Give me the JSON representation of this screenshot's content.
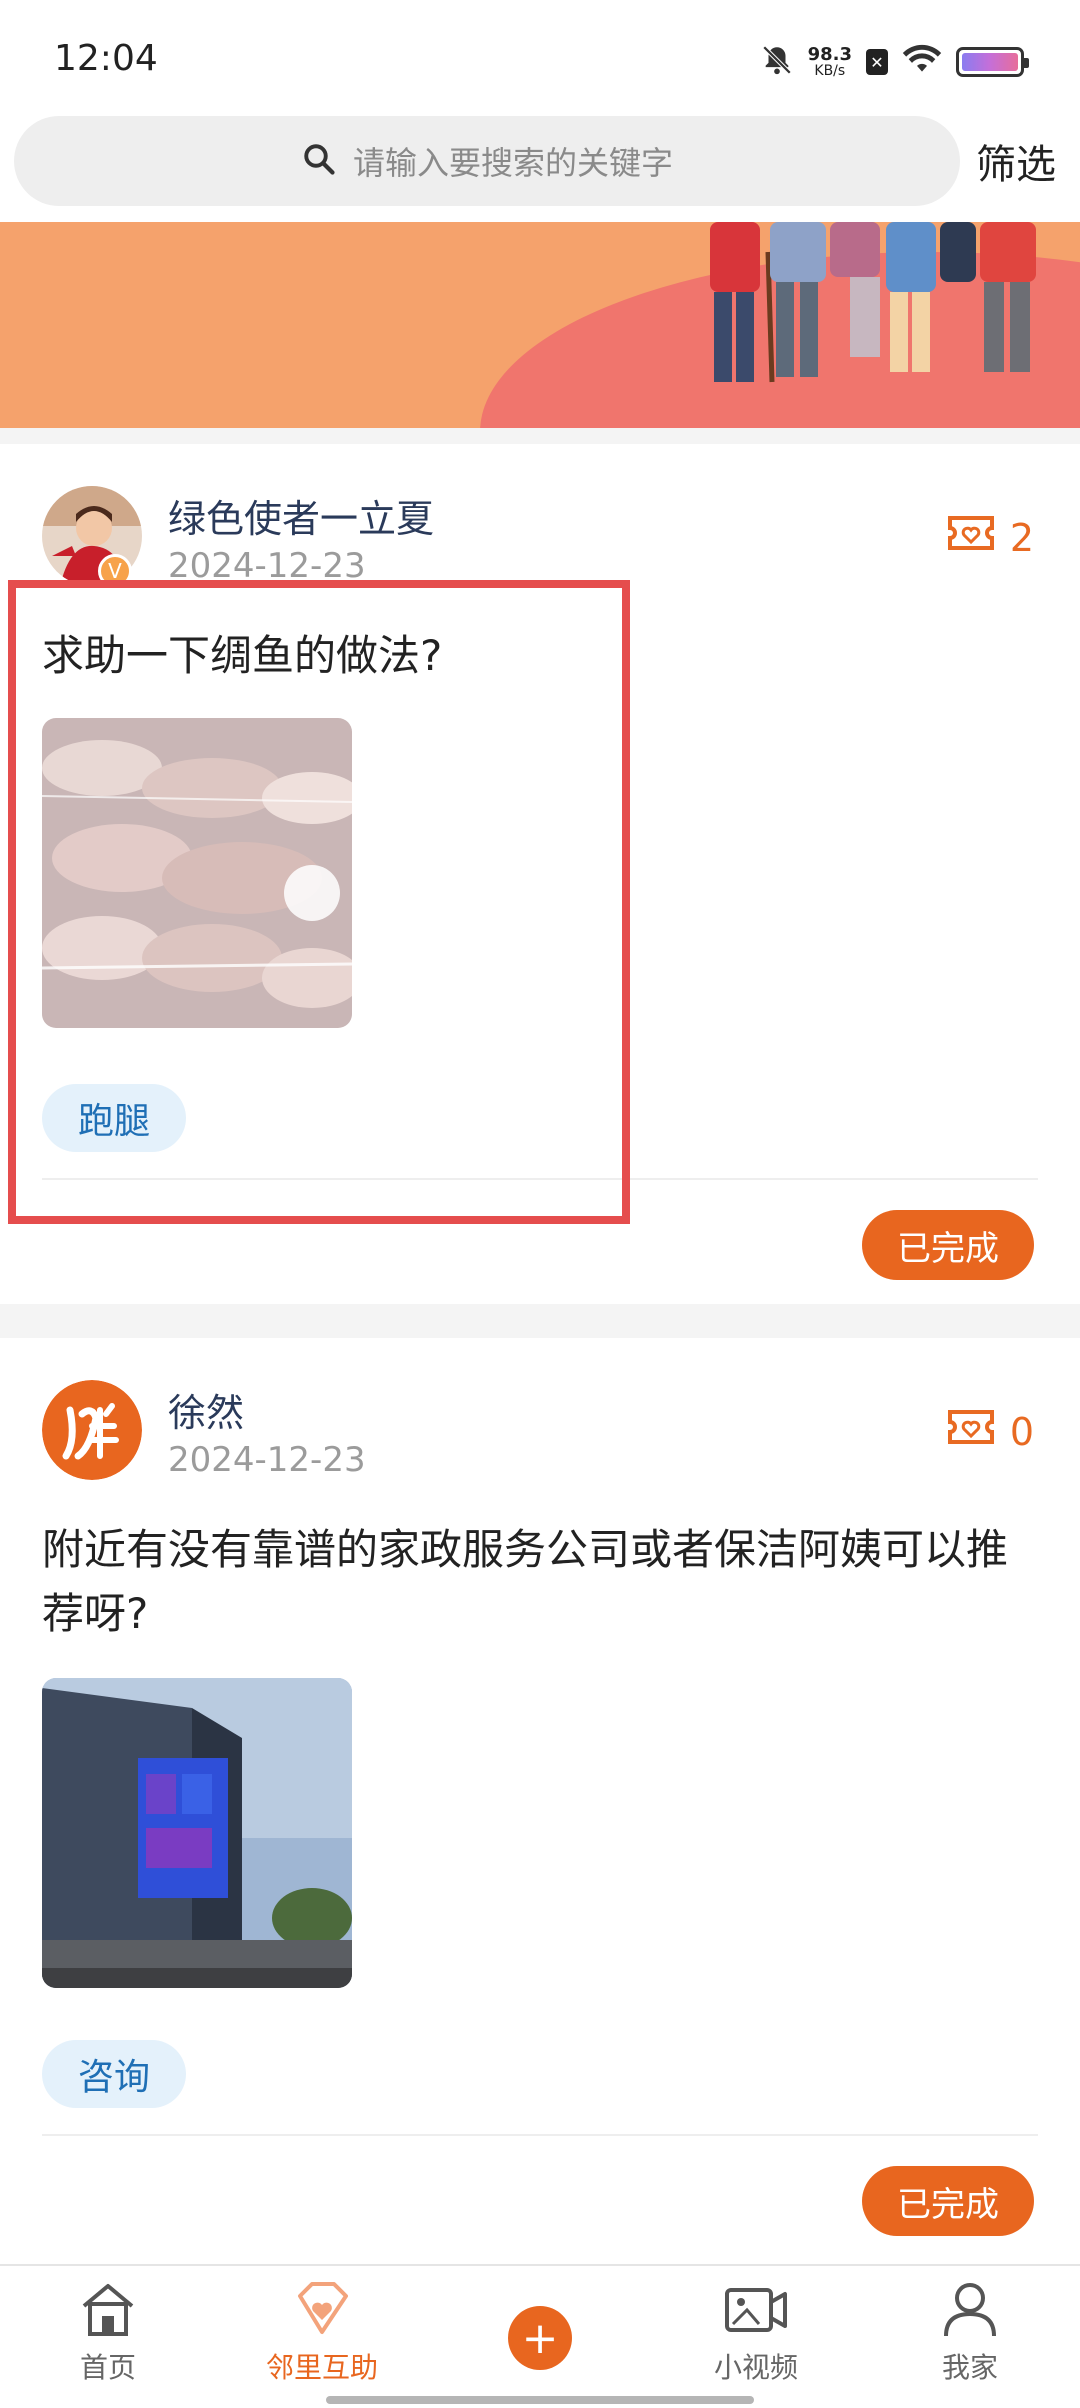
{
  "status_bar": {
    "time": "12:04",
    "net_speed_value": "98.3",
    "net_speed_unit": "KB/s",
    "icons": [
      "mute-bell-icon",
      "sim-x-icon",
      "wifi-icon",
      "battery-icon"
    ]
  },
  "search": {
    "placeholder": "请输入要搜索的关键字",
    "filter_label": "筛选"
  },
  "posts": [
    {
      "username": "绿色使者一立夏",
      "badge": "V",
      "date": "2024-12-23",
      "reward_count": "2",
      "title": "求助一下绸鱼的做法?",
      "tag": "跑腿",
      "status": "已完成"
    },
    {
      "username": "徐然",
      "date": "2024-12-23",
      "reward_count": "0",
      "title": "附近有没有靠谱的家政服务公司或者保洁阿姨可以推荐呀?",
      "tag": "咨询",
      "status": "已完成"
    }
  ],
  "bottom_nav": {
    "items": [
      {
        "label": "首页",
        "icon": "home-icon"
      },
      {
        "label": "邻里互助",
        "icon": "diamond-heart-icon",
        "active": true
      },
      {
        "label": "",
        "icon": "plus-icon"
      },
      {
        "label": "小视频",
        "icon": "video-icon"
      },
      {
        "label": "我家",
        "icon": "person-icon"
      }
    ]
  },
  "colors": {
    "accent": "#e8661f",
    "tag_bg": "#e4f1fb",
    "tag_text": "#1f6fb5",
    "highlight": "#e54d4d"
  }
}
